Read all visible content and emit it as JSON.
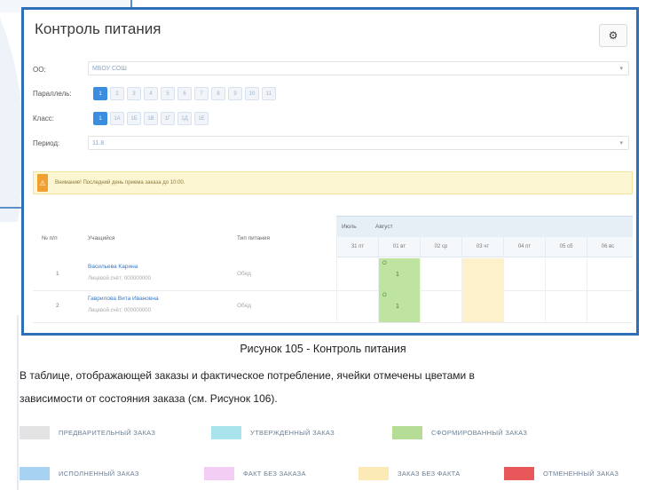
{
  "app": {
    "title": "Контроль питания",
    "settings_icon": "gear-icon",
    "settings_glyph": "⚙"
  },
  "form": {
    "org_label": "ОО:",
    "org_value": "МБОУ СОШ",
    "parallel_label": "Параллель:",
    "parallels": [
      "1",
      "2",
      "3",
      "4",
      "5",
      "6",
      "7",
      "8",
      "9",
      "10",
      "11"
    ],
    "class_label": "Класс:",
    "classes": [
      "1",
      "1А",
      "1Б",
      "1В",
      "1Г",
      "1Д",
      "1Е"
    ],
    "period_label": "Период:",
    "period_value": "11.8"
  },
  "alert": {
    "icon": "warning-icon",
    "glyph": "⚠",
    "text": "Внимание! Последний день приема заказа до 10:00."
  },
  "table": {
    "col_num": "№ п/п",
    "col_student": "Учащийся",
    "col_meal": "Тип питания",
    "month_prev": "Июль",
    "month_cur": "Август",
    "days": [
      "31 пт",
      "01 вт",
      "02 ср",
      "03 чт",
      "04 пт",
      "05 сб",
      "06 вс"
    ],
    "rows": [
      {
        "num": "1",
        "name": "Васильева Карина",
        "sub": "Лицевой счёт: 000000000",
        "meal": "Обед",
        "tag": "О",
        "qty": "1"
      },
      {
        "num": "2",
        "name": "Гаврилова Вита Ивановна",
        "sub": "Лицевой счёт: 000000000",
        "meal": "Обед",
        "tag": "О",
        "qty": "1"
      }
    ]
  },
  "caption": "Рисунок 105 - Контроль питания",
  "paragraph": {
    "line1": "В таблице, отображающей заказы и фактическое потребление, ячейки отмечены цветами в",
    "line2": "зависимости от состояния заказа (см. Рисунок 106)."
  },
  "legend": [
    {
      "label": "ПРЕДВАРИТЕЛЬНЫЙ ЗАКАЗ",
      "color": "#e3e3e3"
    },
    {
      "label": "УТВЕРЖДЕННЫЙ ЗАКАЗ",
      "color": "#a9e4ec"
    },
    {
      "label": "СФОРМИРОВАННЫЙ ЗАКАЗ",
      "color": "#b5dd95"
    },
    {
      "label": "ИСПОЛНЕННЫЙ ЗАКАЗ",
      "color": "#a8d2f2"
    },
    {
      "label": "ФАКТ БЕЗ ЗАКАЗА",
      "color": "#f3cdf3"
    },
    {
      "label": "ЗАКАЗ БЕЗ ФАКТА",
      "color": "#fbe9b6"
    },
    {
      "label": "ОТМЕНЕННЫЙ ЗАКАЗ",
      "color": "#e8575a"
    }
  ]
}
